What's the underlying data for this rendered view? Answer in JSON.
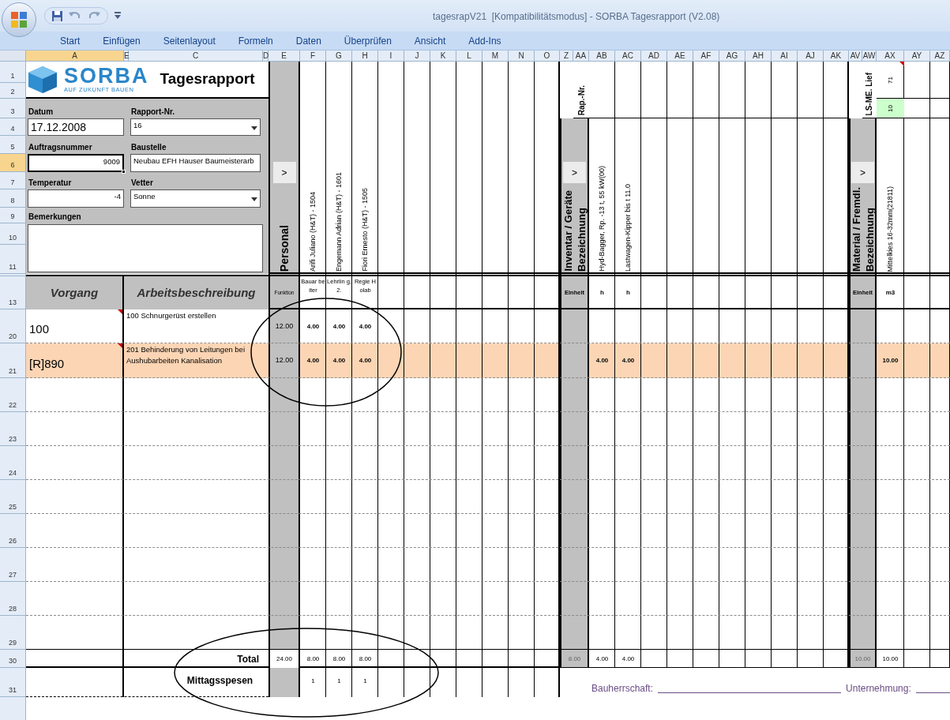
{
  "window": {
    "title": "tagesrapV21  [Kompatibilitätsmodus] - SORBA Tagesrapport (V2.08)"
  },
  "ribbon_tabs": [
    "Start",
    "Einfügen",
    "Seitenlayout",
    "Formeln",
    "Daten",
    "Überprüfen",
    "Ansicht",
    "Add-Ins"
  ],
  "column_headers": [
    {
      "label": "A",
      "selected": true
    },
    {
      "label": "E",
      "selected": false
    },
    {
      "label": "C",
      "selected": false
    },
    {
      "label": "D",
      "selected": false
    },
    {
      "label": "E",
      "selected": false
    },
    {
      "label": "F",
      "selected": false
    },
    {
      "label": "G",
      "selected": false
    },
    {
      "label": "H",
      "selected": false
    },
    {
      "label": "I",
      "selected": false
    },
    {
      "label": "J",
      "selected": false
    },
    {
      "label": "K",
      "selected": false
    },
    {
      "label": "L",
      "selected": false
    },
    {
      "label": "M",
      "selected": false
    },
    {
      "label": "N",
      "selected": false
    },
    {
      "label": "O",
      "selected": false
    },
    {
      "label": "Z",
      "selected": false
    },
    {
      "label": "AA",
      "selected": false
    },
    {
      "label": "AB",
      "selected": false
    },
    {
      "label": "AC",
      "selected": false
    },
    {
      "label": "AD",
      "selected": false
    },
    {
      "label": "AE",
      "selected": false
    },
    {
      "label": "AF",
      "selected": false
    },
    {
      "label": "AG",
      "selected": false
    },
    {
      "label": "AH",
      "selected": false
    },
    {
      "label": "AI",
      "selected": false
    },
    {
      "label": "AJ",
      "selected": false
    },
    {
      "label": "AK",
      "selected": false
    },
    {
      "label": "AV",
      "selected": false
    },
    {
      "label": "AW",
      "selected": false
    },
    {
      "label": "AX",
      "selected": false
    },
    {
      "label": "AY",
      "selected": false
    },
    {
      "label": "AZ",
      "selected": false
    }
  ],
  "row_headers": [
    {
      "label": "1",
      "selected": false
    },
    {
      "label": "2",
      "selected": false
    },
    {
      "label": "3",
      "selected": false
    },
    {
      "label": "4",
      "selected": false
    },
    {
      "label": "5",
      "selected": false
    },
    {
      "label": "6",
      "selected": true
    },
    {
      "label": "7",
      "selected": false
    },
    {
      "label": "8",
      "selected": false
    },
    {
      "label": "9",
      "selected": false
    },
    {
      "label": "10",
      "selected": false
    },
    {
      "label": "11",
      "selected": false
    },
    {
      "label": "13",
      "selected": false
    },
    {
      "label": "20",
      "selected": false
    },
    {
      "label": "21",
      "selected": false
    },
    {
      "label": "22",
      "selected": false
    },
    {
      "label": "23",
      "selected": false
    },
    {
      "label": "24",
      "selected": false
    },
    {
      "label": "25",
      "selected": false
    },
    {
      "label": "26",
      "selected": false
    },
    {
      "label": "27",
      "selected": false
    },
    {
      "label": "28",
      "selected": false
    },
    {
      "label": "29",
      "selected": false
    },
    {
      "label": "30",
      "selected": false
    },
    {
      "label": "31",
      "selected": false
    }
  ],
  "form": {
    "logo_text": "SORBA",
    "logo_tagline": "AUF ZUKUNFT BAUEN",
    "title": "Tagesrapport",
    "remarks_label": "Bemerkungen",
    "fields": [
      {
        "label": "Datum",
        "value": "17.12.2008",
        "kind": "text",
        "selected": false
      },
      {
        "label": "Rapport-Nr.",
        "value": "16",
        "kind": "dropdown",
        "selected": false
      },
      {
        "label": "Auftragsnummer",
        "value": "9009",
        "kind": "number",
        "selected": true
      },
      {
        "label": "Baustelle",
        "value": "Neubau EFH Hauser Baumeisterarb",
        "kind": "text",
        "selected": false
      },
      {
        "label": "Temperatur",
        "value": "-4",
        "kind": "number",
        "selected": false
      },
      {
        "label": "Vetter",
        "value": "Sonne",
        "kind": "dropdown",
        "selected": false
      }
    ]
  },
  "personal": {
    "title": "Personal",
    "button": ">",
    "unit_label": "Funktion",
    "workers": [
      {
        "name": "Arifi Juliano (H&T) - 1504",
        "function": "Bauar beiter"
      },
      {
        "name": "Engemann Adrian (H&T) - 1601",
        "function": "Lehrlin g, 2."
      },
      {
        "name": "Fiori Ernesto (H&T) - 1505",
        "function": "Regie Holab"
      }
    ]
  },
  "inventar": {
    "title": "Inventar / Geräte",
    "subtitle": "Bezeichnung",
    "button": ">",
    "unit_label": "Einheit",
    "number_label": "Rap.-Nr.",
    "items": [
      {
        "name": "Hyd-Bagger, Rp. -13 t, 55 kW(00)",
        "unit": "h"
      },
      {
        "name": "Lastwagen-Kipper bis t 11.0",
        "unit": "h"
      }
    ]
  },
  "material": {
    "title": "Material / Fremdl.",
    "subtitle": "Bezeichnung",
    "button": ">",
    "unit_label": "Einheit",
    "number_label": "LS-ME. Lief",
    "items": [
      {
        "name": "Mittelkies 16-32mm(21811)",
        "unit": "m3",
        "delivery_no": "71",
        "ls_me": "10",
        "comment": true
      }
    ]
  },
  "table": {
    "columns": [
      "Vorgang",
      "Arbeitsbeschreibung"
    ],
    "rows": [
      {
        "vorgang": "100",
        "beschreibung": "100 Schnurgerüst erstellen",
        "highlighted": false,
        "comment": true,
        "funktion": "12.00",
        "personal": [
          "4.00",
          "4.00",
          "4.00"
        ],
        "inventar": [],
        "material": []
      },
      {
        "vorgang": "[R]890",
        "beschreibung": "201 Behinderung von Leitungen bei Aushubarbeiten Kanalisation",
        "highlighted": true,
        "comment": true,
        "funktion": "12.00",
        "personal": [
          "4.00",
          "4.00",
          "4.00"
        ],
        "inventar": [
          "4.00",
          "4.00"
        ],
        "material": [
          "10.00"
        ]
      }
    ]
  },
  "totals": {
    "label": "Total",
    "funktion": "24.00",
    "personal": [
      "8.00",
      "8.00",
      "8.00"
    ],
    "inventar_sum": "8.00",
    "inventar": [
      "4.00",
      "4.00"
    ],
    "material_sum": "10.00",
    "material": [
      "10.00"
    ]
  },
  "mittagsspesen": {
    "label": "Mittagsspesen",
    "personal": [
      "1",
      "1",
      "1"
    ]
  },
  "signatures": [
    "Bauherrschaft:",
    "Unternehmung:"
  ]
}
